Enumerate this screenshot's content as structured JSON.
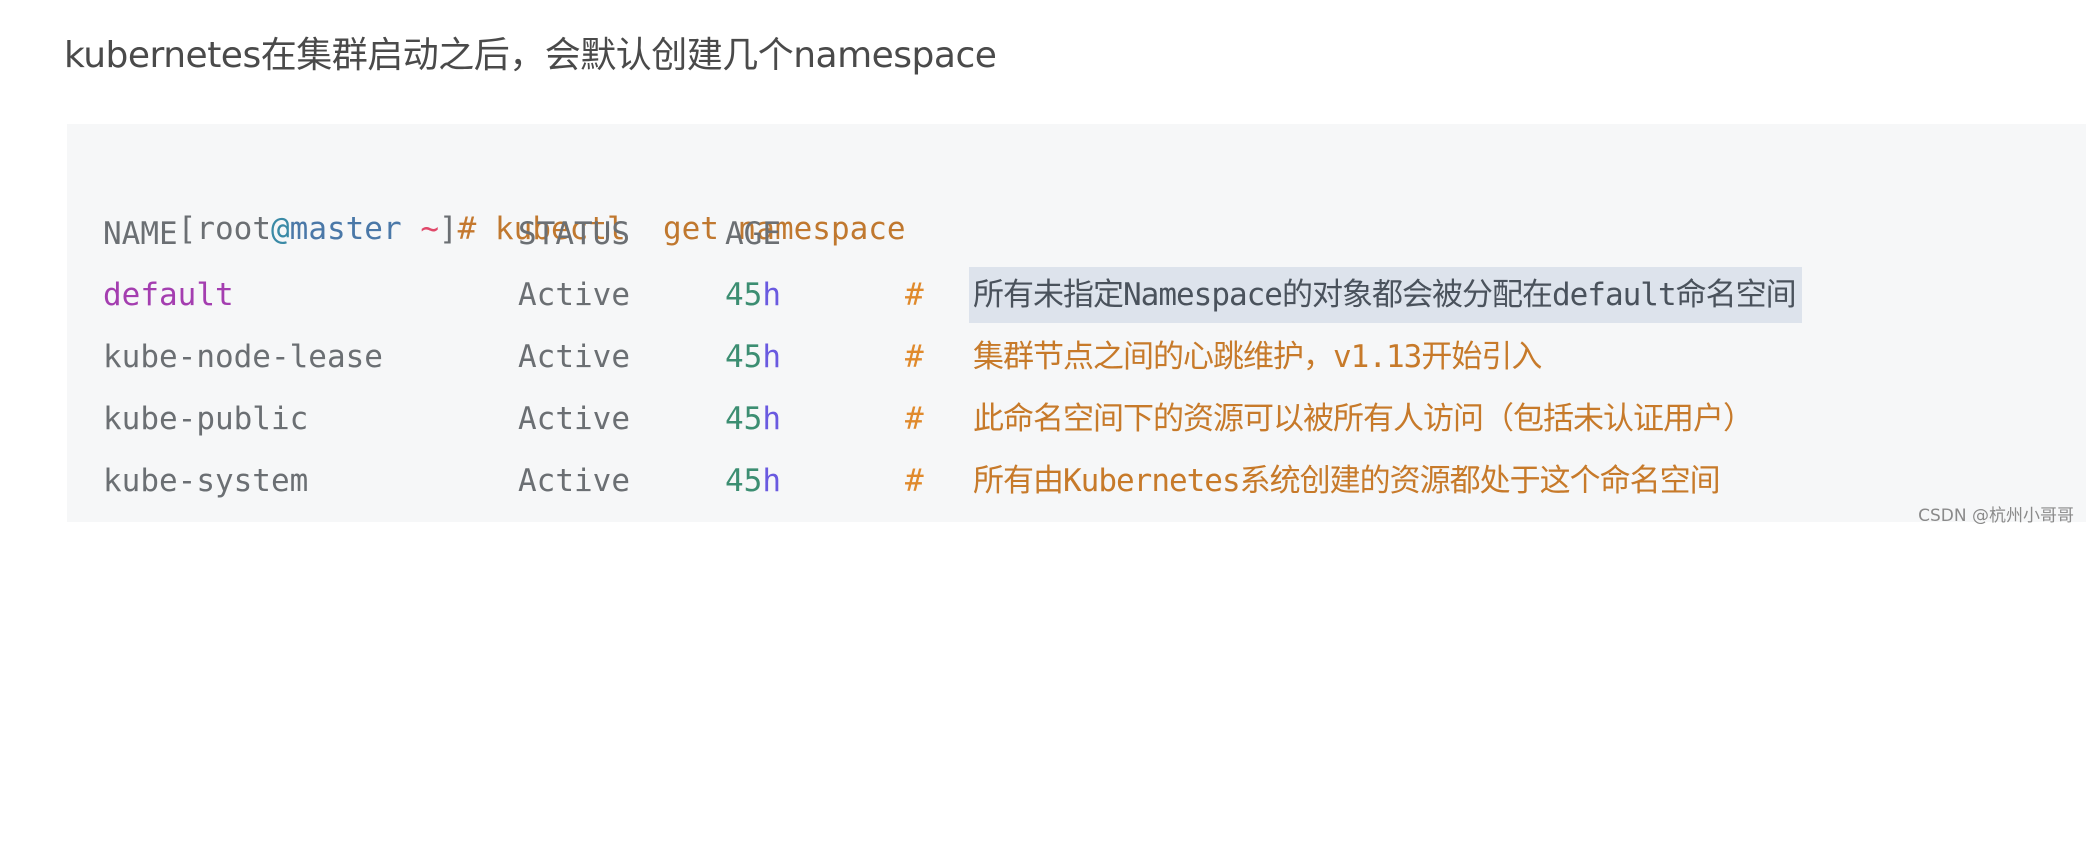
{
  "title": "kubernetes在集群启动之后，会默认创建几个namespace",
  "terminal": {
    "prompt": {
      "open_bracket": "[",
      "user": "root",
      "at": "@",
      "host": "master",
      "cwd": "~",
      "close_bracket": "]",
      "symbol": "#"
    },
    "command": "kubectl  get namespace",
    "headers": {
      "name": "NAME",
      "status": "STATUS",
      "age": "AGE"
    },
    "rows": [
      {
        "name": "default",
        "status": "Active",
        "age_value": "45",
        "age_unit": "h",
        "comment_marker": "#",
        "comment": "所有未指定Namespace的对象都会被分配在default命名空间",
        "selected": true
      },
      {
        "name": "kube-node-lease",
        "status": "Active",
        "age_value": "45",
        "age_unit": "h",
        "comment_marker": "#",
        "comment": "集群节点之间的心跳维护，v1.13开始引入",
        "selected": false
      },
      {
        "name": "kube-public",
        "status": "Active",
        "age_value": "45",
        "age_unit": "h",
        "comment_marker": "#",
        "comment": "此命名空间下的资源可以被所有人访问（包括未认证用户）",
        "selected": false
      },
      {
        "name": "kube-system",
        "status": "Active",
        "age_value": "45",
        "age_unit": "h",
        "comment_marker": "#",
        "comment": "所有由Kubernetes系统创建的资源都处于这个命名空间",
        "selected": false
      }
    ]
  },
  "colors": {
    "code_background": "#f6f7f8",
    "selection_background": "#dde3ec",
    "command": "#c0782f",
    "comment": "#c77a2a",
    "default_namespace": "#a43eb0",
    "age_number": "#3c8e72",
    "age_unit": "#6a5ae0",
    "host": "#4a78a8",
    "cwd": "#e0486a"
  },
  "watermark": "CSDN @杭州小哥哥"
}
